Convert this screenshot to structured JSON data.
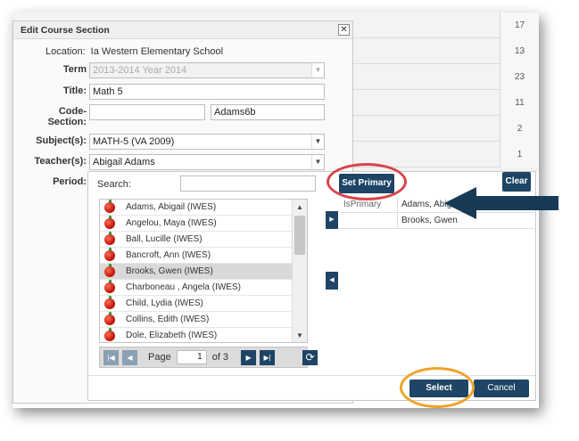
{
  "background": {
    "numbers": [
      "17",
      "13",
      "23",
      "11",
      "2",
      "1"
    ]
  },
  "dialog": {
    "title": "Edit Course Section",
    "close_glyph": "✕",
    "location_label": "Location:",
    "location_value": "Ia Western Elementary School",
    "term_label": "Term",
    "term_value": "2013-2014 Year 2014",
    "title_label": "Title:",
    "title_value": "Math 5",
    "code_label": "Code-",
    "section_label": "Section:",
    "code_value": "",
    "section_value": "Adams6b",
    "subjects_label": "Subject(s):",
    "subjects_value": "MATH-5 (VA 2009)",
    "teachers_label": "Teacher(s):",
    "teachers_value": "Abigail Adams",
    "period_label": "Period:"
  },
  "picker": {
    "search_label": "Search:",
    "search_value": "",
    "teachers": [
      "Adams, Abigail (IWES)",
      "Angelou, Maya (IWES)",
      "Ball, Lucille (IWES)",
      "Bancroft, Ann (IWES)",
      "Brooks, Gwen (IWES)",
      "Charboneau , Angela (IWES)",
      "Child, Lydia (IWES)",
      "Collins, Edith (IWES)",
      "Dole, Elizabeth (IWES)"
    ],
    "selected_index": 4,
    "page_label": "Page",
    "page_value": "1",
    "page_total": "of 3",
    "set_primary_label": "Set Primary",
    "clear_label": "Clear",
    "assigned_header": "IsPrimary",
    "assigned": [
      "Adams, Abigail",
      "Brooks, Gwen"
    ],
    "select_label": "Select",
    "cancel_label": "Cancel"
  },
  "icons": {
    "dropdown": "▼",
    "scroll_up": "▲",
    "scroll_down": "▼",
    "first": "|◀",
    "prev": "◀",
    "next": "▶",
    "last": "▶|",
    "refresh": "⟳",
    "move_right": "▶",
    "move_left": "◀"
  },
  "colors": {
    "button": "#1e4466",
    "annotation_red": "#d9434a",
    "annotation_orange": "#f0a329",
    "arrow": "#173a57"
  }
}
